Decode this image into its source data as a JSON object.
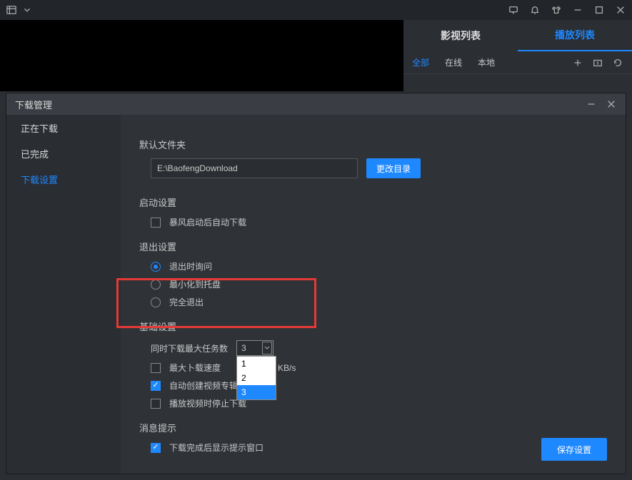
{
  "playerSidebar": {
    "tabs": [
      "影视列表",
      "播放列表"
    ],
    "activeTab": 1,
    "subtabs": [
      "全部",
      "在线",
      "本地"
    ],
    "activeSub": 0
  },
  "dlModal": {
    "title": "下载管理",
    "sideItems": [
      "正在下载",
      "已完成",
      "下载设置"
    ],
    "activeSide": 2,
    "sections": {
      "folder": {
        "title": "默认文件夹",
        "path": "E:\\BaofengDownload",
        "btn": "更改目录"
      },
      "startup": {
        "title": "启动设置",
        "opt1": "暴风启动后自动下载"
      },
      "exit": {
        "title": "退出设置",
        "opts": [
          "退出时询问",
          "最小化到托盘",
          "完全退出"
        ],
        "sel": 0
      },
      "basic": {
        "title": "基础设置",
        "maxTaskLabel": "同时下载最大任务数",
        "maxTaskValue": "3",
        "options": [
          "1",
          "2",
          "3"
        ],
        "hoverIdx": 2,
        "maxSpeed": "最大卜载速度",
        "unit": "KB/s",
        "autoCreate": "自动创建视频专辑文",
        "pauseOnPlay": "播放视频时停止下载"
      },
      "msg": {
        "title": "消息提示",
        "showTip": "下载完成后显示提示窗口"
      },
      "saveBtn": "保存设置"
    }
  }
}
